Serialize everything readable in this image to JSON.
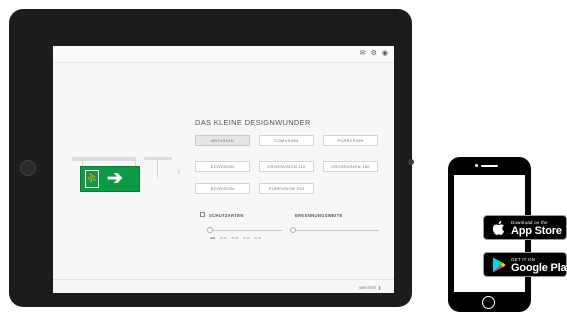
{
  "screen": {
    "top_icons": [
      {
        "name": "email-icon",
        "glyph": "✉"
      },
      {
        "name": "settings-icon",
        "glyph": "⚙"
      },
      {
        "name": "globe-icon",
        "glyph": "◉"
      }
    ],
    "heading": "DAS KLEINE DESIGNWUNDER",
    "options": [
      {
        "label": "ARTVSION",
        "selected": true
      },
      {
        "label": "COMVSION",
        "selected": false
      },
      {
        "label": "PUREVSION",
        "selected": false
      },
      {
        "label": "ECOVSION",
        "selected": false
      },
      {
        "label": "CROSSVSION 110",
        "selected": false
      },
      {
        "label": "CROSSVSION 160",
        "selected": false
      },
      {
        "label": "ECOVSION",
        "selected": false
      },
      {
        "label": "PUREVSION 310",
        "selected": false
      }
    ],
    "schutzarten_label": "SCHUTZARTEN",
    "schutzarten_ticks": [
      "Alle",
      "IP 40",
      "IP 42",
      "IP 44",
      "IP 65"
    ],
    "schutzarten_value": 0,
    "erkennungsweite_label": "ERKENNUNGSWEITE",
    "erkennungsweite_ticks": [
      "Alle",
      "10 m",
      "15 m",
      "20 m",
      "22 m",
      "25 m",
      "30 m",
      "32 m",
      "35 m",
      "40 m",
      "44 m"
    ],
    "erkennungsweite_value": 0,
    "next_label": "WEITER ❯",
    "preview_chevron": "›"
  },
  "badges": {
    "appstore": {
      "small": "Download on the",
      "big": "App Store"
    },
    "googleplay": {
      "small": "GET IT ON",
      "big": "Google Play"
    }
  },
  "colors": {
    "exit_sign": "#0c9a44",
    "tablet_frame": "#1c1c1e",
    "phone_frame": "#000000"
  }
}
